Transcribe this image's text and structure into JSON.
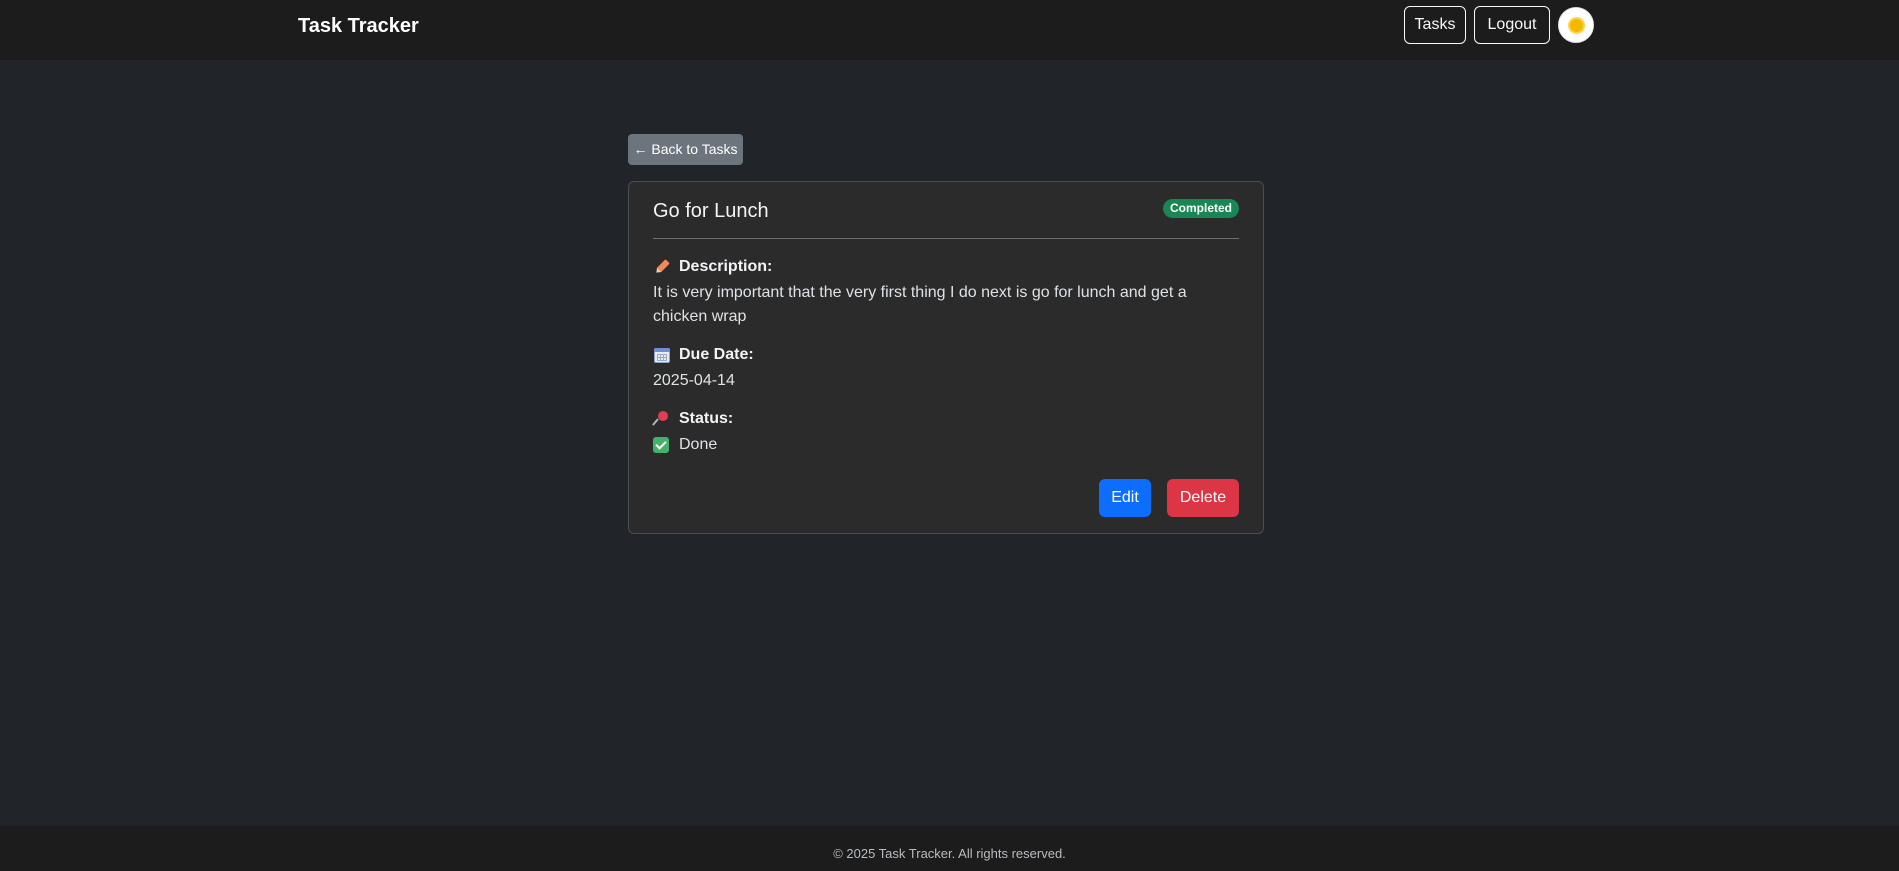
{
  "navbar": {
    "brand": "Task Tracker",
    "tasks_label": "Tasks",
    "logout_label": "Logout",
    "theme_toggle_icon": "sun-icon"
  },
  "back_button": {
    "label": "← Back to Tasks"
  },
  "task": {
    "title": "Go for Lunch",
    "status_badge": "Completed",
    "description_label": "Description:",
    "description": "It is very important that the very first thing I do next is go for lunch and get a chicken wrap",
    "due_date_label": "Due Date:",
    "due_date": "2025-04-14",
    "status_label": "Status:",
    "status_value": "Done",
    "icons": {
      "description": "pencil-icon",
      "due_date": "calendar-icon",
      "status": "pushpin-icon",
      "status_value": "check-box-icon"
    }
  },
  "actions": {
    "edit_label": "Edit",
    "delete_label": "Delete"
  },
  "footer": {
    "text": "© 2025 Task Tracker. All rights reserved."
  },
  "colors": {
    "background": "#212529",
    "navbar": "#1c1c1c",
    "card": "#2b2b2b",
    "badge_success": "#198754",
    "edit_primary": "#0d6efd",
    "delete_danger": "#dc3545",
    "back_secondary": "#6c757d"
  }
}
